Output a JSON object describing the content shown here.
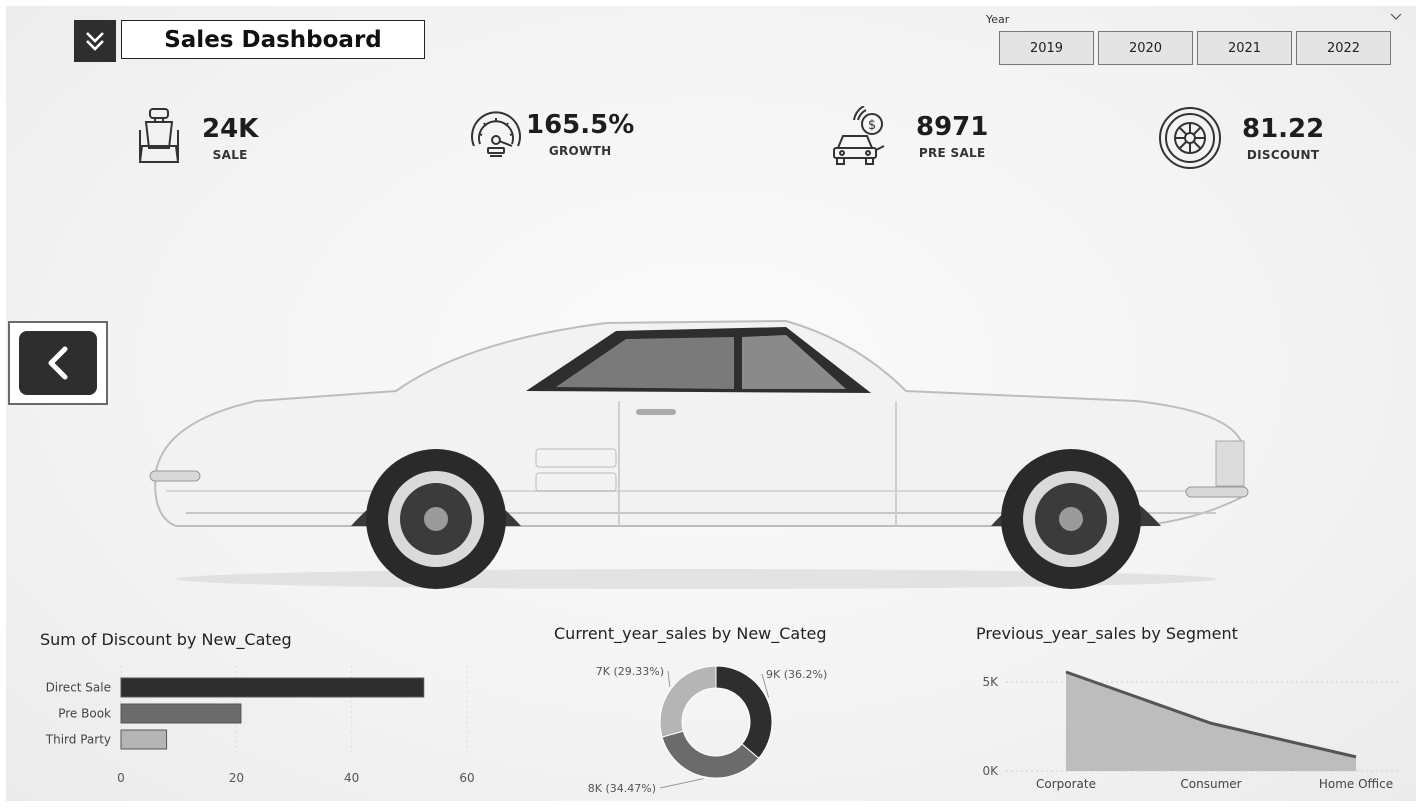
{
  "header": {
    "title": "Sales Dashboard",
    "menu_icon": "double-chevron-down-icon"
  },
  "year_slicer": {
    "label": "Year",
    "options": [
      "2019",
      "2020",
      "2021",
      "2022"
    ]
  },
  "kpis": [
    {
      "value": "24K",
      "label": "SALE",
      "icon": "car-seat-icon"
    },
    {
      "value": "165.5%",
      "label": "GROWTH",
      "icon": "speedometer-icon"
    },
    {
      "value": "8971",
      "label": "PRE SALE",
      "icon": "car-dollar-icon"
    },
    {
      "value": "81.22",
      "label": "DISCOUNT",
      "icon": "tire-icon"
    }
  ],
  "nav": {
    "back_icon": "chevron-left-icon"
  },
  "colors": {
    "dark": "#2e2e2e",
    "mid": "#6b6b6b",
    "light": "#b5b5b5",
    "area_fill": "#bdbdbd",
    "area_line": "#555555"
  },
  "chart_data": [
    {
      "type": "bar",
      "orientation": "horizontal",
      "title": "Sum of Discount by New_Categ",
      "categories": [
        "Direct Sale",
        "Pre Book",
        "Third Party"
      ],
      "values": [
        52.5,
        20.8,
        7.9
      ],
      "xlim": [
        0,
        60
      ],
      "xticks": [
        "0",
        "20",
        "40",
        "60"
      ],
      "grid": true
    },
    {
      "type": "pie",
      "donut": true,
      "title": "Current_year_sales by New_Categ",
      "slices": [
        {
          "value": 36.2,
          "label": "9K (36.2%)"
        },
        {
          "value": 34.47,
          "label": "8K (34.47%)"
        },
        {
          "value": 29.33,
          "label": "7K (29.33%)"
        }
      ]
    },
    {
      "type": "area",
      "title": "Previous_year_sales by Segment",
      "categories": [
        "Corporate",
        "Consumer",
        "Home Office"
      ],
      "values": [
        5600,
        2700,
        800
      ],
      "ylim": [
        0,
        5600
      ],
      "yticks": [
        "5K",
        "0K"
      ],
      "grid": true
    }
  ]
}
